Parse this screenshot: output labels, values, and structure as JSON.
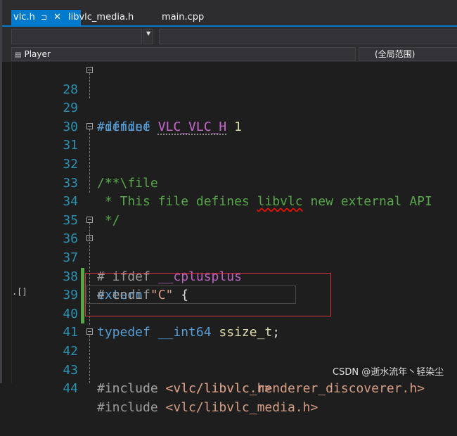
{
  "tabs": [
    {
      "label": "vlc.h",
      "active": true,
      "pin_icon": "pin-icon",
      "close_icon": "close-icon"
    },
    {
      "label": "libvlc_media.h",
      "active": false
    },
    {
      "label": "main.cpp",
      "active": false
    }
  ],
  "nav": {
    "project_scope": "Player",
    "global_scope": "(全局范围)"
  },
  "code_lines": [
    {
      "num": "28"
    },
    {
      "num": "29"
    },
    {
      "num": "30"
    },
    {
      "num": "31"
    },
    {
      "num": "32"
    },
    {
      "num": "33"
    },
    {
      "num": "34"
    },
    {
      "num": "35"
    },
    {
      "num": "36"
    },
    {
      "num": "37"
    },
    {
      "num": "38"
    },
    {
      "num": "39"
    },
    {
      "num": "40"
    },
    {
      "num": "41"
    },
    {
      "num": "42"
    },
    {
      "num": "43"
    },
    {
      "num": "44"
    }
  ],
  "code_text": {
    "l28_a": "#ifndef ",
    "l28_b": "VLC_VLC_H",
    "l29_a": "#define ",
    "l29_b": "VLC_VLC_H",
    "l29_c": " 1",
    "l31": "/**",
    "l32": " * \\file",
    "l33_a": " * This file defines ",
    "l33_b": "libvlc",
    "l33_c": " new external API",
    "l34": " */",
    "l36_a": "# ifdef ",
    "l36_b": "__cplusplus",
    "l37_a": "extern ",
    "l37_b": "\"C\"",
    "l37_c": " {",
    "l38": "# endif",
    "l40_a": "typedef ",
    "l40_b": "__int64",
    "l40_c": " ",
    "l40_d": "ssize_t",
    "l40_e": ";",
    "l42_a": "#include ",
    "l42_b": "<vlc/libvlc.h>",
    "l43_a": "#include ",
    "l43_b": "<vlc/libvlc_renderer_discoverer.h>",
    "l44_a": "#include ",
    "l44_b": "<vlc/libvlc_media.h>"
  },
  "gutter_marker": ".[]",
  "watermark": "CSDN @逝水流年丶轻染尘",
  "colors": {
    "accent": "#007acc",
    "keyword": "#569cd6",
    "macro": "#bd63c5",
    "comment": "#57a64a",
    "string": "#d69d85",
    "line_number": "#2b91af",
    "highlight_box": "#e0303a"
  }
}
